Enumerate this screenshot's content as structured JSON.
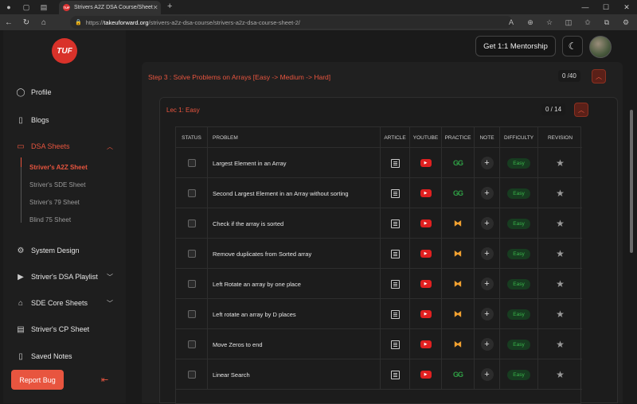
{
  "browser": {
    "tab_title": "Strivers A2Z DSA Course/Sheet",
    "url_prefix": "https://",
    "url_domain": "takeuforward.org",
    "url_path": "/strivers-a2z-dsa-course/strivers-a2z-dsa-course-sheet-2/",
    "favicon_text": "TUF"
  },
  "logo_text": "TUF",
  "sidebar": {
    "profile": "Profile",
    "blogs": "Blogs",
    "dsa_sheets": "DSA Sheets",
    "sub_items": [
      "Striver's A2Z Sheet",
      "Striver's SDE Sheet",
      "Striver's 79 Sheet",
      "Blind 75 Sheet"
    ],
    "system_design": "System Design",
    "dsa_playlist": "Striver's DSA Playlist",
    "sde_core": "SDE Core Sheets",
    "cp_sheet": "Striver's CP Sheet",
    "saved_notes": "Saved Notes",
    "report_bug": "Report Bug"
  },
  "header": {
    "mentorship": "Get 1:1 Mentorship"
  },
  "step": {
    "title": "Step 3 : Solve Problems on Arrays [Easy -> Medium -> Hard]",
    "counter": "0 /40"
  },
  "lecture": {
    "title": "Lec 1: Easy",
    "counter": "0 / 14"
  },
  "table": {
    "headers": [
      "STATUS",
      "PROBLEM",
      "ARTICLE",
      "YOUTUBE",
      "PRACTICE",
      "NOTE",
      "DIFFICULTY",
      "REVISION"
    ],
    "rows": [
      {
        "problem": "Largest Element in an Array",
        "practice": "gfg",
        "difficulty": "Easy"
      },
      {
        "problem": "Second Largest Element in an Array without sorting",
        "practice": "gfg",
        "difficulty": "Easy"
      },
      {
        "problem": "Check if the array is sorted",
        "practice": "codingninjas",
        "difficulty": "Easy"
      },
      {
        "problem": "Remove duplicates from Sorted array",
        "practice": "codingninjas",
        "difficulty": "Easy"
      },
      {
        "problem": "Left Rotate an array by one place",
        "practice": "codingninjas",
        "difficulty": "Easy"
      },
      {
        "problem": "Left rotate an array by D places",
        "practice": "codingninjas",
        "difficulty": "Easy"
      },
      {
        "problem": "Move Zeros to end",
        "practice": "codingninjas",
        "difficulty": "Easy"
      },
      {
        "problem": "Linear Search",
        "practice": "gfg",
        "difficulty": "Easy"
      }
    ]
  },
  "colors": {
    "accent": "#e8553f",
    "easy_text": "#3ab54a",
    "easy_bg": "#173c20",
    "youtube": "#e02020",
    "gfg": "#2f9e44",
    "codingninjas": "#f0a030"
  }
}
